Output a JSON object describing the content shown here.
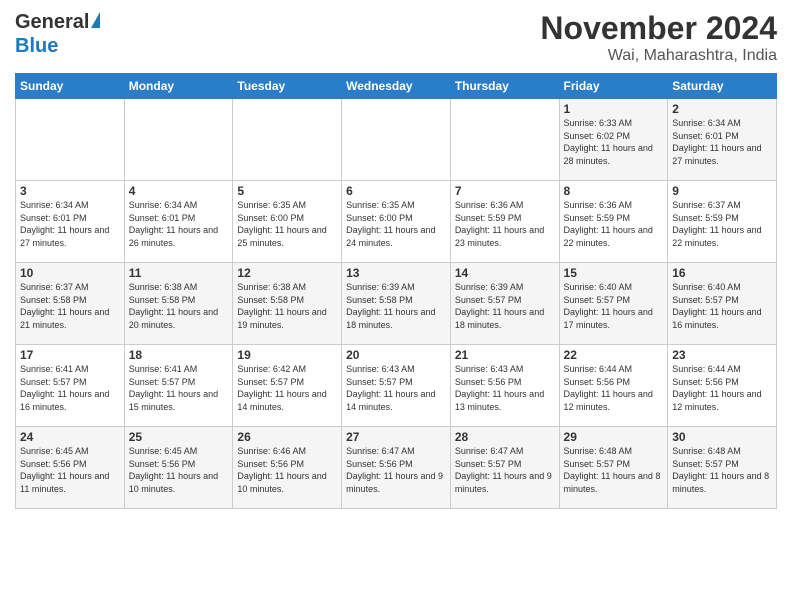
{
  "logo": {
    "line1": "General",
    "line2": "Blue"
  },
  "title": "November 2024",
  "location": "Wai, Maharashtra, India",
  "days_of_week": [
    "Sunday",
    "Monday",
    "Tuesday",
    "Wednesday",
    "Thursday",
    "Friday",
    "Saturday"
  ],
  "weeks": [
    [
      {
        "day": "",
        "info": ""
      },
      {
        "day": "",
        "info": ""
      },
      {
        "day": "",
        "info": ""
      },
      {
        "day": "",
        "info": ""
      },
      {
        "day": "",
        "info": ""
      },
      {
        "day": "1",
        "info": "Sunrise: 6:33 AM\nSunset: 6:02 PM\nDaylight: 11 hours and 28 minutes."
      },
      {
        "day": "2",
        "info": "Sunrise: 6:34 AM\nSunset: 6:01 PM\nDaylight: 11 hours and 27 minutes."
      }
    ],
    [
      {
        "day": "3",
        "info": "Sunrise: 6:34 AM\nSunset: 6:01 PM\nDaylight: 11 hours and 27 minutes."
      },
      {
        "day": "4",
        "info": "Sunrise: 6:34 AM\nSunset: 6:01 PM\nDaylight: 11 hours and 26 minutes."
      },
      {
        "day": "5",
        "info": "Sunrise: 6:35 AM\nSunset: 6:00 PM\nDaylight: 11 hours and 25 minutes."
      },
      {
        "day": "6",
        "info": "Sunrise: 6:35 AM\nSunset: 6:00 PM\nDaylight: 11 hours and 24 minutes."
      },
      {
        "day": "7",
        "info": "Sunrise: 6:36 AM\nSunset: 5:59 PM\nDaylight: 11 hours and 23 minutes."
      },
      {
        "day": "8",
        "info": "Sunrise: 6:36 AM\nSunset: 5:59 PM\nDaylight: 11 hours and 22 minutes."
      },
      {
        "day": "9",
        "info": "Sunrise: 6:37 AM\nSunset: 5:59 PM\nDaylight: 11 hours and 22 minutes."
      }
    ],
    [
      {
        "day": "10",
        "info": "Sunrise: 6:37 AM\nSunset: 5:58 PM\nDaylight: 11 hours and 21 minutes."
      },
      {
        "day": "11",
        "info": "Sunrise: 6:38 AM\nSunset: 5:58 PM\nDaylight: 11 hours and 20 minutes."
      },
      {
        "day": "12",
        "info": "Sunrise: 6:38 AM\nSunset: 5:58 PM\nDaylight: 11 hours and 19 minutes."
      },
      {
        "day": "13",
        "info": "Sunrise: 6:39 AM\nSunset: 5:58 PM\nDaylight: 11 hours and 18 minutes."
      },
      {
        "day": "14",
        "info": "Sunrise: 6:39 AM\nSunset: 5:57 PM\nDaylight: 11 hours and 18 minutes."
      },
      {
        "day": "15",
        "info": "Sunrise: 6:40 AM\nSunset: 5:57 PM\nDaylight: 11 hours and 17 minutes."
      },
      {
        "day": "16",
        "info": "Sunrise: 6:40 AM\nSunset: 5:57 PM\nDaylight: 11 hours and 16 minutes."
      }
    ],
    [
      {
        "day": "17",
        "info": "Sunrise: 6:41 AM\nSunset: 5:57 PM\nDaylight: 11 hours and 16 minutes."
      },
      {
        "day": "18",
        "info": "Sunrise: 6:41 AM\nSunset: 5:57 PM\nDaylight: 11 hours and 15 minutes."
      },
      {
        "day": "19",
        "info": "Sunrise: 6:42 AM\nSunset: 5:57 PM\nDaylight: 11 hours and 14 minutes."
      },
      {
        "day": "20",
        "info": "Sunrise: 6:43 AM\nSunset: 5:57 PM\nDaylight: 11 hours and 14 minutes."
      },
      {
        "day": "21",
        "info": "Sunrise: 6:43 AM\nSunset: 5:56 PM\nDaylight: 11 hours and 13 minutes."
      },
      {
        "day": "22",
        "info": "Sunrise: 6:44 AM\nSunset: 5:56 PM\nDaylight: 11 hours and 12 minutes."
      },
      {
        "day": "23",
        "info": "Sunrise: 6:44 AM\nSunset: 5:56 PM\nDaylight: 11 hours and 12 minutes."
      }
    ],
    [
      {
        "day": "24",
        "info": "Sunrise: 6:45 AM\nSunset: 5:56 PM\nDaylight: 11 hours and 11 minutes."
      },
      {
        "day": "25",
        "info": "Sunrise: 6:45 AM\nSunset: 5:56 PM\nDaylight: 11 hours and 10 minutes."
      },
      {
        "day": "26",
        "info": "Sunrise: 6:46 AM\nSunset: 5:56 PM\nDaylight: 11 hours and 10 minutes."
      },
      {
        "day": "27",
        "info": "Sunrise: 6:47 AM\nSunset: 5:56 PM\nDaylight: 11 hours and 9 minutes."
      },
      {
        "day": "28",
        "info": "Sunrise: 6:47 AM\nSunset: 5:57 PM\nDaylight: 11 hours and 9 minutes."
      },
      {
        "day": "29",
        "info": "Sunrise: 6:48 AM\nSunset: 5:57 PM\nDaylight: 11 hours and 8 minutes."
      },
      {
        "day": "30",
        "info": "Sunrise: 6:48 AM\nSunset: 5:57 PM\nDaylight: 11 hours and 8 minutes."
      }
    ]
  ]
}
